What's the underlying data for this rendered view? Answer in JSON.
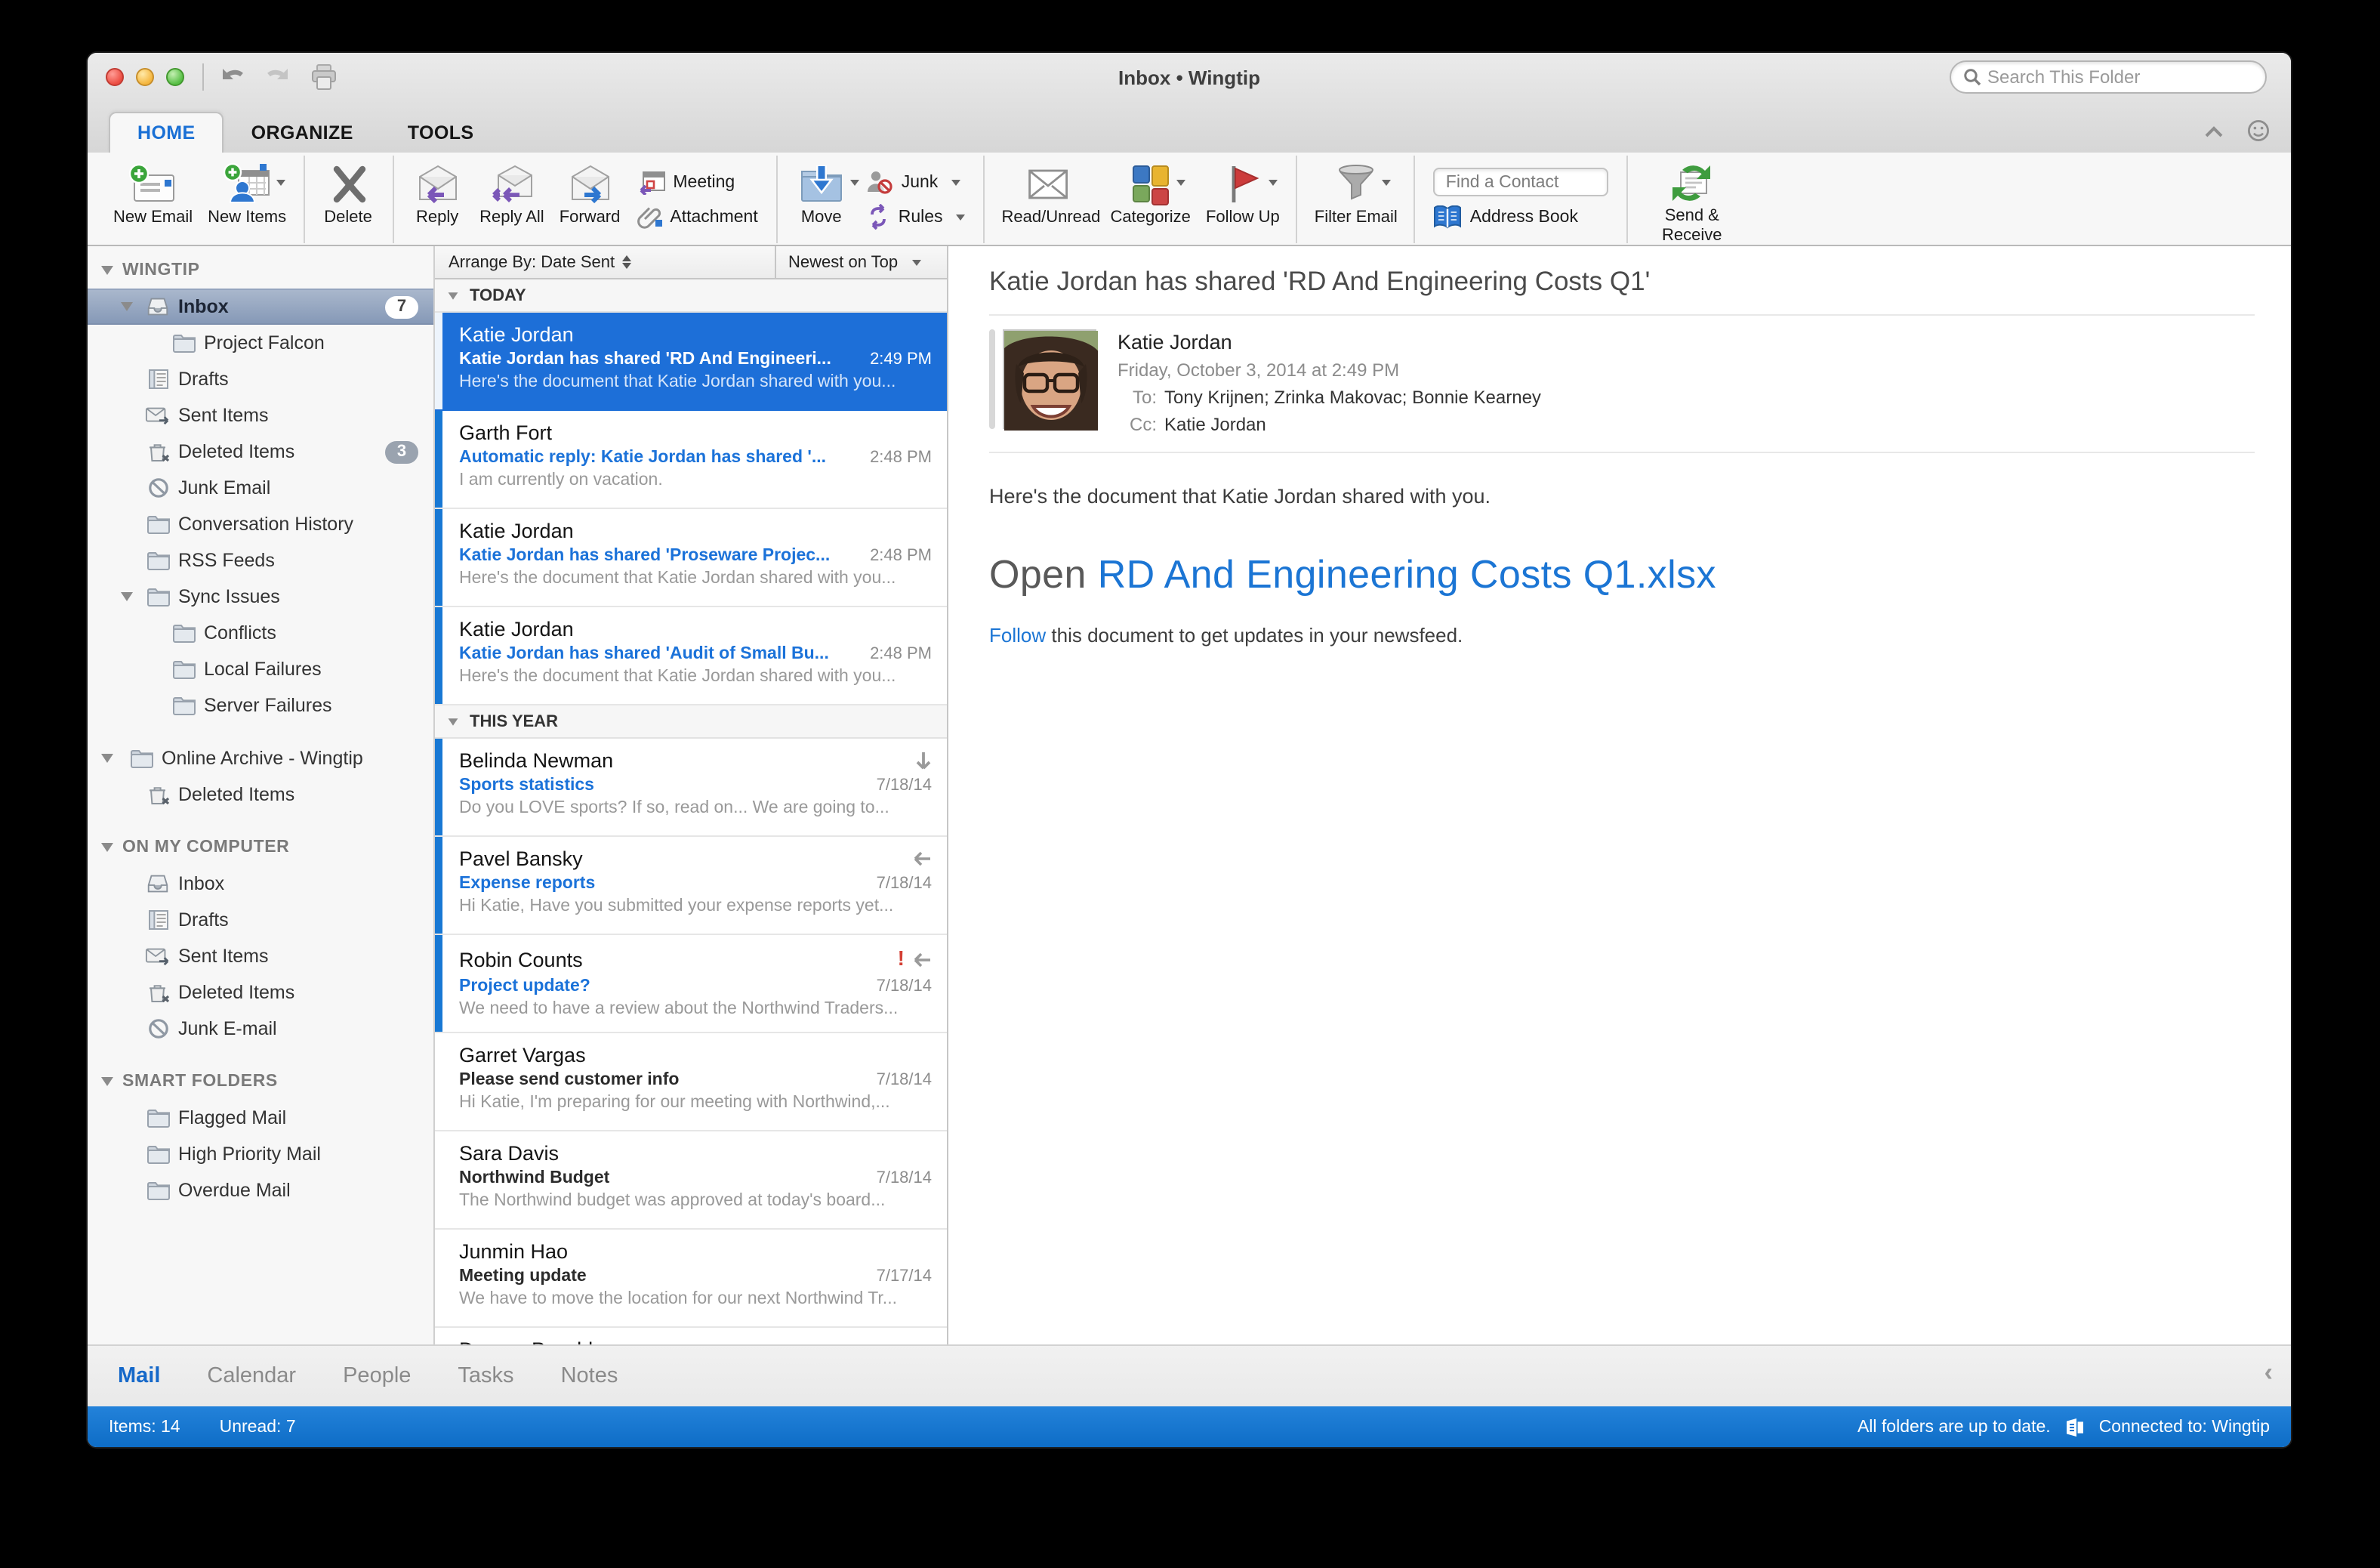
{
  "titlebar": {
    "title": "Inbox • Wingtip",
    "search_placeholder": "Search This Folder",
    "icons": [
      "undo-icon",
      "redo-icon",
      "print-icon"
    ]
  },
  "tabs": [
    {
      "label": "HOME",
      "active": true
    },
    {
      "label": "ORGANIZE",
      "active": false
    },
    {
      "label": "TOOLS",
      "active": false
    }
  ],
  "ribbon": {
    "groups": [
      {
        "items": [
          {
            "kind": "large",
            "label": "New Email",
            "icon": "new-email-icon"
          },
          {
            "kind": "large",
            "label": "New Items",
            "icon": "new-items-icon",
            "dropdown": true
          }
        ]
      },
      {
        "items": [
          {
            "kind": "large",
            "label": "Delete",
            "icon": "delete-icon"
          }
        ]
      },
      {
        "items": [
          {
            "kind": "large",
            "label": "Reply",
            "icon": "reply-icon"
          },
          {
            "kind": "large",
            "label": "Reply All",
            "icon": "reply-all-icon"
          },
          {
            "kind": "large",
            "label": "Forward",
            "icon": "forward-icon"
          },
          {
            "kind": "stack",
            "rows": [
              {
                "label": "Meeting",
                "icon": "meeting-icon"
              },
              {
                "label": "Attachment",
                "icon": "attachment-icon"
              }
            ]
          }
        ]
      },
      {
        "items": [
          {
            "kind": "large",
            "label": "Move",
            "icon": "move-icon",
            "dropdown": true
          },
          {
            "kind": "stack",
            "rows": [
              {
                "label": "Junk",
                "icon": "junk-icon",
                "dropdown": true
              },
              {
                "label": "Rules",
                "icon": "rules-icon",
                "dropdown": true
              }
            ]
          }
        ]
      },
      {
        "items": [
          {
            "kind": "large",
            "label": "Read/Unread",
            "icon": "read-unread-icon"
          },
          {
            "kind": "large",
            "label": "Categorize",
            "icon": "categorize-icon",
            "dropdown": true
          },
          {
            "kind": "large",
            "label": "Follow Up",
            "icon": "follow-up-icon",
            "dropdown": true
          }
        ]
      },
      {
        "items": [
          {
            "kind": "large",
            "label": "Filter Email",
            "icon": "filter-email-icon",
            "dropdown": true
          }
        ]
      },
      {
        "items": [
          {
            "kind": "stack",
            "rows": [
              {
                "label": "Find a Contact",
                "icon": "find-contact-box"
              },
              {
                "label": "Address Book",
                "icon": "address-book-icon"
              }
            ]
          }
        ]
      },
      {
        "items": [
          {
            "kind": "large",
            "label": "Send & Receive",
            "icon": "send-receive-icon"
          }
        ]
      }
    ]
  },
  "sidebar": {
    "sections": [
      {
        "header": "WINGTIP",
        "items": [
          {
            "label": "Inbox",
            "icon": "inbox-icon",
            "depth": 1,
            "disclosure": true,
            "selected": true,
            "badge": "7"
          },
          {
            "label": "Project Falcon",
            "icon": "folder-icon",
            "depth": 2
          },
          {
            "label": "Drafts",
            "icon": "drafts-icon",
            "depth": 1
          },
          {
            "label": "Sent Items",
            "icon": "sent-icon",
            "depth": 1
          },
          {
            "label": "Deleted Items",
            "icon": "trash-icon",
            "depth": 1,
            "badge": "3",
            "badge_gray": true
          },
          {
            "label": "Junk Email",
            "icon": "junk-block-icon",
            "depth": 1
          },
          {
            "label": "Conversation History",
            "icon": "folder-icon",
            "depth": 1
          },
          {
            "label": "RSS Feeds",
            "icon": "folder-icon",
            "depth": 1
          },
          {
            "label": "Sync Issues",
            "icon": "folder-icon",
            "depth": 1,
            "disclosure": true
          },
          {
            "label": "Conflicts",
            "icon": "folder-icon",
            "depth": 2
          },
          {
            "label": "Local Failures",
            "icon": "folder-icon",
            "depth": 2
          },
          {
            "label": "Server Failures",
            "icon": "folder-icon",
            "depth": 2
          }
        ]
      },
      {
        "header": null,
        "items": [
          {
            "label": "Online Archive - Wingtip",
            "icon": "folder-icon",
            "depth": 0,
            "disclosure": true
          },
          {
            "label": "Deleted Items",
            "icon": "trash-icon",
            "depth": 1
          }
        ]
      },
      {
        "header": "ON MY COMPUTER",
        "items": [
          {
            "label": "Inbox",
            "icon": "inbox-icon",
            "depth": 1
          },
          {
            "label": "Drafts",
            "icon": "drafts-icon",
            "depth": 1
          },
          {
            "label": "Sent Items",
            "icon": "sent-icon",
            "depth": 1
          },
          {
            "label": "Deleted Items",
            "icon": "trash-icon",
            "depth": 1
          },
          {
            "label": "Junk E-mail",
            "icon": "junk-block-icon",
            "depth": 1
          }
        ]
      },
      {
        "header": "SMART FOLDERS",
        "items": [
          {
            "label": "Flagged Mail",
            "icon": "folder-icon",
            "depth": 1
          },
          {
            "label": "High Priority Mail",
            "icon": "folder-icon",
            "depth": 1
          },
          {
            "label": "Overdue Mail",
            "icon": "folder-icon",
            "depth": 1
          }
        ]
      }
    ]
  },
  "message_list": {
    "arrange_by": "Arrange By: Date Sent",
    "sort": "Newest on Top",
    "sections": [
      {
        "header": "TODAY",
        "messages": [
          {
            "sender": "Katie Jordan",
            "subject": "Katie Jordan has shared 'RD And Engineeri...",
            "time": "2:49 PM",
            "preview": "Here's the document that Katie Jordan shared with you...",
            "unread": true,
            "selected": true,
            "flags": []
          },
          {
            "sender": "Garth Fort",
            "subject": "Automatic reply: Katie Jordan has shared '...",
            "time": "2:48 PM",
            "preview": "I am currently on vacation.",
            "unread": true,
            "flags": []
          },
          {
            "sender": "Katie Jordan",
            "subject": "Katie Jordan has shared 'Proseware Projec...",
            "time": "2:48 PM",
            "preview": "Here's the document that Katie Jordan shared with you...",
            "unread": true,
            "flags": []
          },
          {
            "sender": "Katie Jordan",
            "subject": "Katie Jordan has shared 'Audit of Small Bu...",
            "time": "2:48 PM",
            "preview": "Here's the document that Katie Jordan shared with you...",
            "unread": true,
            "flags": []
          }
        ]
      },
      {
        "header": "THIS YEAR",
        "messages": [
          {
            "sender": "Belinda Newman",
            "subject": "Sports statistics",
            "time": "7/18/14",
            "preview": "Do you LOVE sports? If so, read on... We are going to...",
            "unread": true,
            "flags": [
              "low-importance-icon"
            ]
          },
          {
            "sender": "Pavel Bansky",
            "subject": "Expense reports",
            "time": "7/18/14",
            "preview": "Hi Katie, Have you submitted your expense reports yet...",
            "unread": true,
            "flags": [
              "replied-icon"
            ]
          },
          {
            "sender": "Robin Counts",
            "subject": "Project update?",
            "time": "7/18/14",
            "preview": "We need to have a review about the Northwind Traders...",
            "unread": true,
            "flags": [
              "high-importance-icon",
              "replied-icon"
            ]
          },
          {
            "sender": "Garret Vargas",
            "subject": "Please send customer info",
            "time": "7/18/14",
            "preview": "Hi Katie, I'm preparing for our meeting with Northwind,...",
            "unread": false,
            "flags": []
          },
          {
            "sender": "Sara Davis",
            "subject": "Northwind Budget",
            "time": "7/18/14",
            "preview": "The Northwind budget was approved at today's board...",
            "unread": false,
            "flags": []
          },
          {
            "sender": "Junmin Hao",
            "subject": "Meeting update",
            "time": "7/17/14",
            "preview": "We have to move the location for our next Northwind Tr...",
            "unread": false,
            "flags": []
          },
          {
            "sender": "Dorena Paschke",
            "subject": "",
            "time": "",
            "preview": "",
            "unread": false,
            "flags": []
          }
        ]
      }
    ]
  },
  "reading_pane": {
    "subject": "Katie Jordan has shared 'RD And Engineering Costs Q1'",
    "sender": "Katie Jordan",
    "date": "Friday, October 3, 2014 at 2:49 PM",
    "to_label": "To:",
    "to": "Tony Krijnen;  Zrinka Makovac;  Bonnie Kearney",
    "cc_label": "Cc:",
    "cc": "Katie Jordan",
    "body_line": "Here's the document that Katie Jordan shared with you.",
    "open_label": "Open",
    "open_link": "RD And Engineering Costs Q1.xlsx",
    "follow_link": "Follow",
    "follow_rest": " this document to get updates in your newsfeed."
  },
  "nav": {
    "tabs": [
      "Mail",
      "Calendar",
      "People",
      "Tasks",
      "Notes"
    ],
    "active": "Mail"
  },
  "status_bar": {
    "items": "Items: 14",
    "unread": "Unread: 7",
    "sync": "All folders are up to date.",
    "connection": "Connected to: Wingtip"
  },
  "colors": {
    "accent_blue": "#1d6fd8",
    "unread_blue": "#1878d4",
    "link_blue": "#1b72d9",
    "status_bar_blue": "#1173d0",
    "selected_sidebar": "#96a7c0"
  }
}
